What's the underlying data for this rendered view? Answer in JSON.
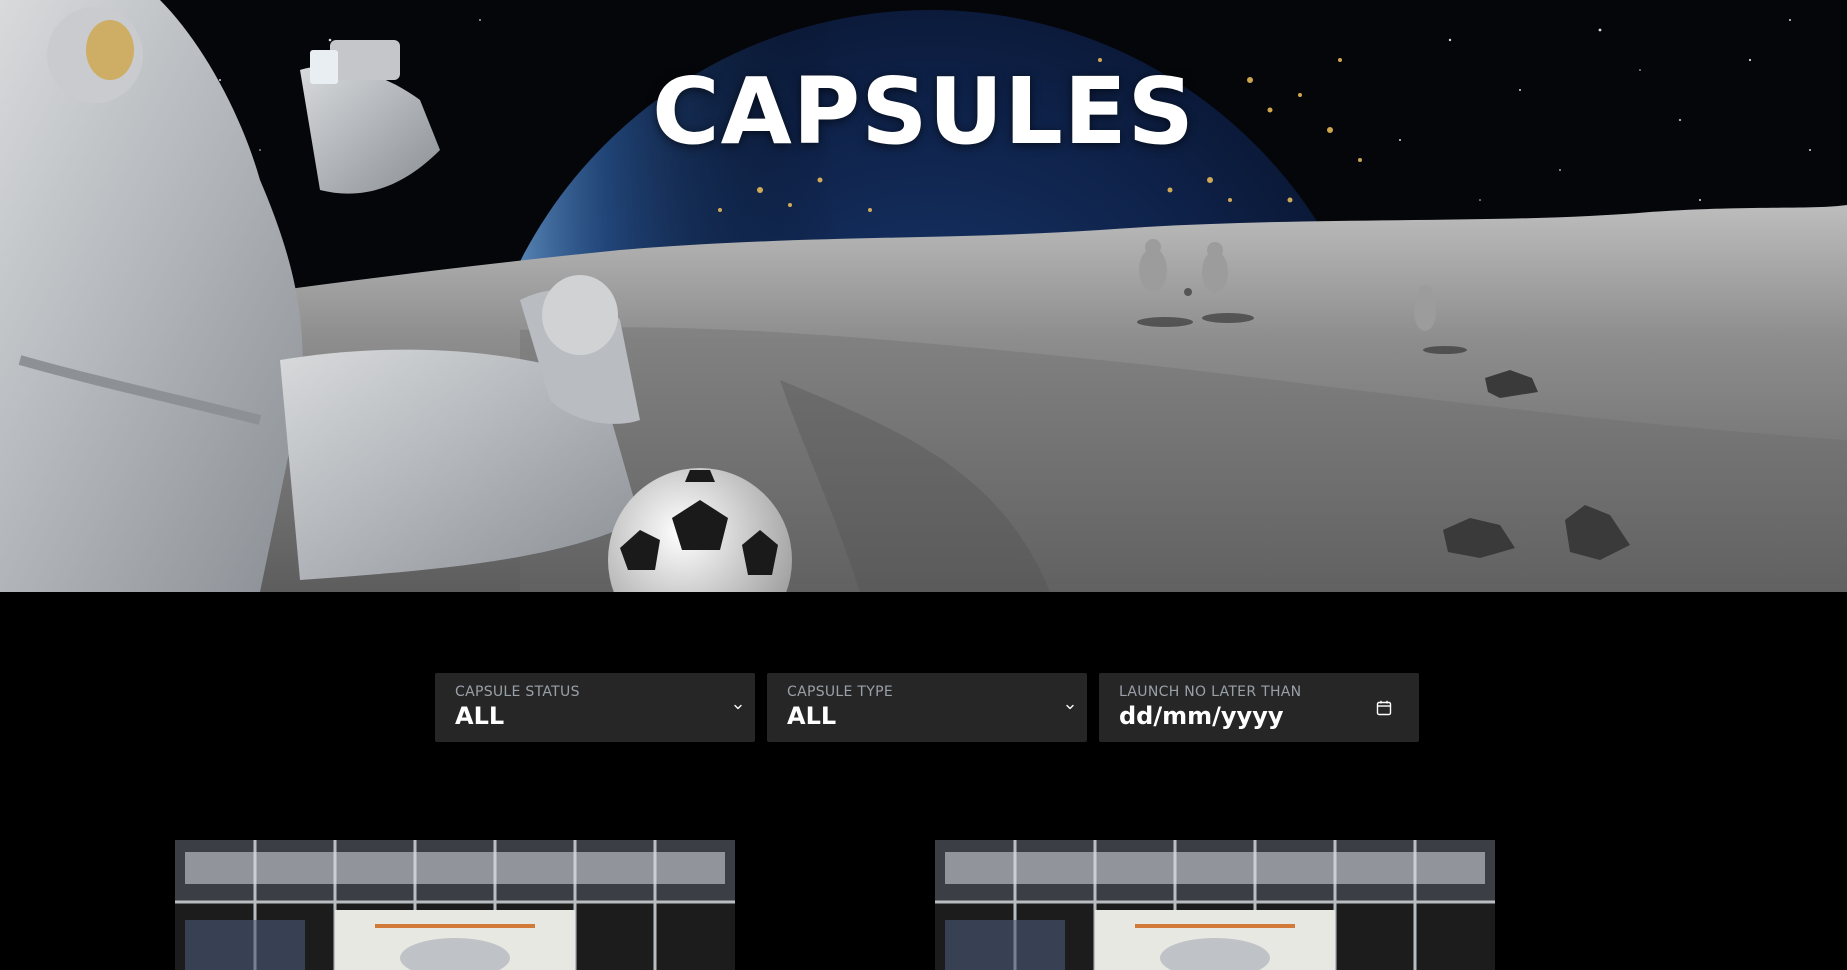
{
  "hero": {
    "title": "CAPSULES"
  },
  "filters": {
    "status": {
      "label": "CAPSULE STATUS",
      "value": "ALL",
      "icon": "chevron-down-icon"
    },
    "type": {
      "label": "CAPSULE TYPE",
      "value": "ALL",
      "icon": "chevron-down-icon"
    },
    "launch": {
      "label": "LAUNCH NO LATER THAN",
      "placeholder": "dd/mm/yyyy",
      "icon": "calendar-icon"
    }
  },
  "colors": {
    "background": "#000000",
    "field_bg": "#262626",
    "field_label": "#9aa0a8",
    "text": "#ffffff"
  }
}
